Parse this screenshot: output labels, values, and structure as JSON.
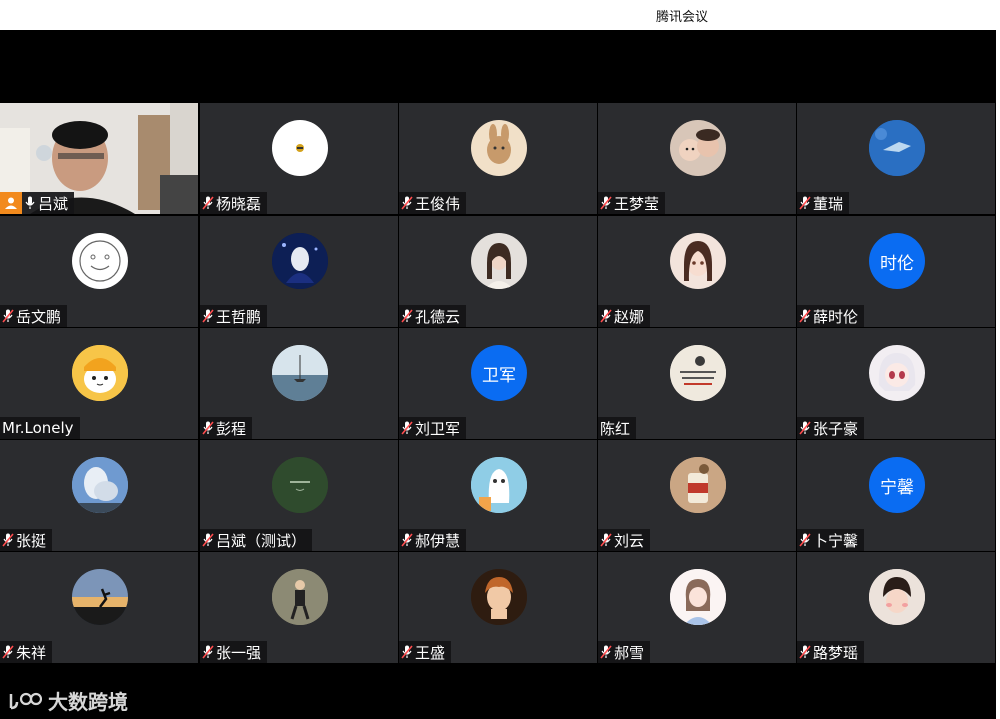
{
  "window": {
    "title": "腾讯会议"
  },
  "participants": [
    {
      "name": "吕斌",
      "video": true,
      "host": true,
      "mic": "on"
    },
    {
      "name": "杨晓磊",
      "mic": "muted",
      "avatar": "small-yellow-icon"
    },
    {
      "name": "王俊伟",
      "mic": "muted",
      "avatar": "cartoon-illustration"
    },
    {
      "name": "王梦莹",
      "mic": "muted",
      "avatar": "photo-family"
    },
    {
      "name": "董瑞",
      "mic": "muted",
      "avatar": "photo-blue-sky"
    },
    {
      "name": "岳文鹏",
      "mic": "muted",
      "avatar": "smiley-sketch"
    },
    {
      "name": "王哲鹏",
      "mic": "muted",
      "avatar": "anime-dark-blue"
    },
    {
      "name": "孔德云",
      "mic": "muted",
      "avatar": "photo-woman"
    },
    {
      "name": "赵娜",
      "mic": "muted",
      "avatar": "anime-girl"
    },
    {
      "name": "薛时伦",
      "mic": "muted",
      "avatar_text": "时伦"
    },
    {
      "name": "Mr.Lonely",
      "mic": "none",
      "avatar": "cartoon-yellow-hat"
    },
    {
      "name": "彭程",
      "mic": "muted",
      "avatar": "photo-sailboat"
    },
    {
      "name": "刘卫军",
      "mic": "muted",
      "avatar_text": "卫军"
    },
    {
      "name": "陈红",
      "mic": "none",
      "avatar": "calligraphy-illustration"
    },
    {
      "name": "张子豪",
      "mic": "muted",
      "avatar": "anime-white-hair"
    },
    {
      "name": "张挺",
      "mic": "muted",
      "avatar": "photo-clouds"
    },
    {
      "name": "吕斌（测试）",
      "mic": "muted",
      "avatar": "dark-green-logo"
    },
    {
      "name": "郝伊慧",
      "mic": "muted",
      "avatar": "cartoon-ghost"
    },
    {
      "name": "刘云",
      "mic": "muted",
      "avatar": "cartoon-drink"
    },
    {
      "name": "卜宁馨",
      "mic": "muted",
      "avatar_text": "宁馨"
    },
    {
      "name": "朱祥",
      "mic": "muted",
      "avatar": "photo-silhouette-jump"
    },
    {
      "name": "张一强",
      "mic": "muted",
      "avatar": "photo-man-standing"
    },
    {
      "name": "王盛",
      "mic": "muted",
      "avatar": "photo-child"
    },
    {
      "name": "郝雪",
      "mic": "muted",
      "avatar": "illustration-girl"
    },
    {
      "name": "路梦瑶",
      "mic": "muted",
      "avatar": "photo-girl-pose"
    }
  ],
  "watermark": {
    "text": "大数跨境",
    "logo": "logo-icon"
  },
  "colors": {
    "tile": "#2b2c2f",
    "text_avatar": "#0a6cf2",
    "muted_mic": "#ff4d4f",
    "host": "#f28a1d"
  }
}
